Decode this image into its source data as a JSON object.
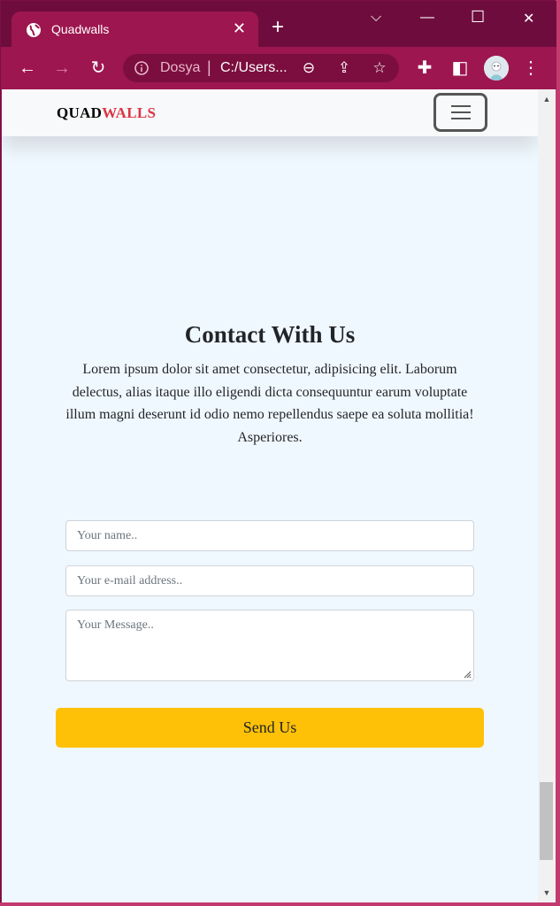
{
  "browser": {
    "tab_title": "Quadwalls",
    "new_tab": "+",
    "window_controls": {
      "list": "⌵",
      "minimize": "—",
      "maximize": "☐",
      "close": "✕"
    },
    "omnibox": {
      "site_label": "Dosya",
      "separator": "|",
      "url": "C:/Users..."
    }
  },
  "site": {
    "brand_part1": "QUAD",
    "brand_part2": "WALLS",
    "brand_accent_color": "#dc3545"
  },
  "contact": {
    "heading": "Contact With Us",
    "lead": "Lorem ipsum dolor sit amet consectetur, adipisicing elit. Laborum delectus, alias itaque illo eligendi dicta consequuntur earum voluptate illum magni deserunt id odio nemo repellendus saepe ea soluta mollitia! Asperiores.",
    "name_placeholder": "Your name..",
    "email_placeholder": "Your e-mail address..",
    "message_placeholder": "Your Message..",
    "send_label": "Send Us",
    "button_color": "#ffc107"
  },
  "icons": [
    "globe-icon",
    "close-icon",
    "back-icon",
    "forward-icon",
    "reload-icon",
    "info-icon",
    "zoom-out-icon",
    "share-icon",
    "star-icon",
    "extensions-icon",
    "side-panel-icon",
    "more-icon",
    "hamburger-icon"
  ]
}
